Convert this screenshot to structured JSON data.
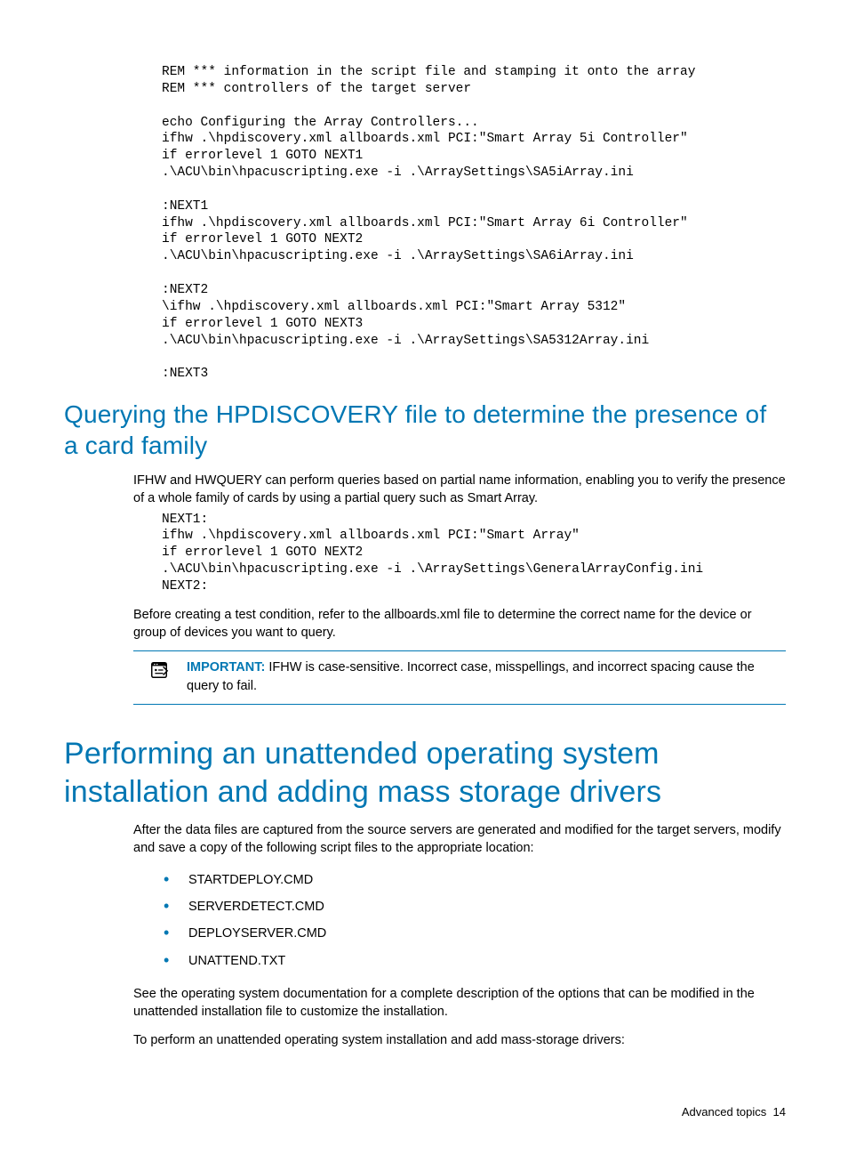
{
  "code1": "REM *** information in the script file and stamping it onto the array\nREM *** controllers of the target server\n\necho Configuring the Array Controllers...\nifhw .\\hpdiscovery.xml allboards.xml PCI:\"Smart Array 5i Controller\"\nif errorlevel 1 GOTO NEXT1\n.\\ACU\\bin\\hpacuscripting.exe -i .\\ArraySettings\\SA5iArray.ini\n\n:NEXT1\nifhw .\\hpdiscovery.xml allboards.xml PCI:\"Smart Array 6i Controller\"\nif errorlevel 1 GOTO NEXT2\n.\\ACU\\bin\\hpacuscripting.exe -i .\\ArraySettings\\SA6iArray.ini\n\n:NEXT2\n\\ifhw .\\hpdiscovery.xml allboards.xml PCI:\"Smart Array 5312\"\nif errorlevel 1 GOTO NEXT3\n.\\ACU\\bin\\hpacuscripting.exe -i .\\ArraySettings\\SA5312Array.ini\n\n:NEXT3",
  "heading_query": "Querying the HPDISCOVERY file to determine the presence of a card family",
  "para_query1": "IFHW and HWQUERY can perform queries based on partial name information, enabling you to verify the presence of a whole family of cards by using a partial query such as Smart Array.",
  "code2": "NEXT1:\nifhw .\\hpdiscovery.xml allboards.xml PCI:\"Smart Array\"\nif errorlevel 1 GOTO NEXT2\n.\\ACU\\bin\\hpacuscripting.exe -i .\\ArraySettings\\GeneralArrayConfig.ini\nNEXT2:",
  "para_query2": "Before creating a test condition, refer to the allboards.xml file to determine the correct name for the device or group of devices you want to query.",
  "note_label": "IMPORTANT:",
  "note_text": "IFHW is case-sensitive. Incorrect case, misspellings, and incorrect spacing cause the query to fail.",
  "heading_perform": "Performing an unattended operating system installation and adding mass storage drivers",
  "para_perform1": "After the data files are captured from the source servers are generated and modified for the target servers, modify and save a copy of the following script files to the appropriate location:",
  "list": {
    "0": "STARTDEPLOY.CMD",
    "1": "SERVERDETECT.CMD",
    "2": "DEPLOYSERVER.CMD",
    "3": "UNATTEND.TXT"
  },
  "para_perform2": "See the operating system documentation for a complete description of the options that can be modified in the unattended installation file to customize the installation.",
  "para_perform3": "To perform an unattended operating system installation and add mass-storage drivers:",
  "footer_section": "Advanced topics",
  "footer_page": "14"
}
